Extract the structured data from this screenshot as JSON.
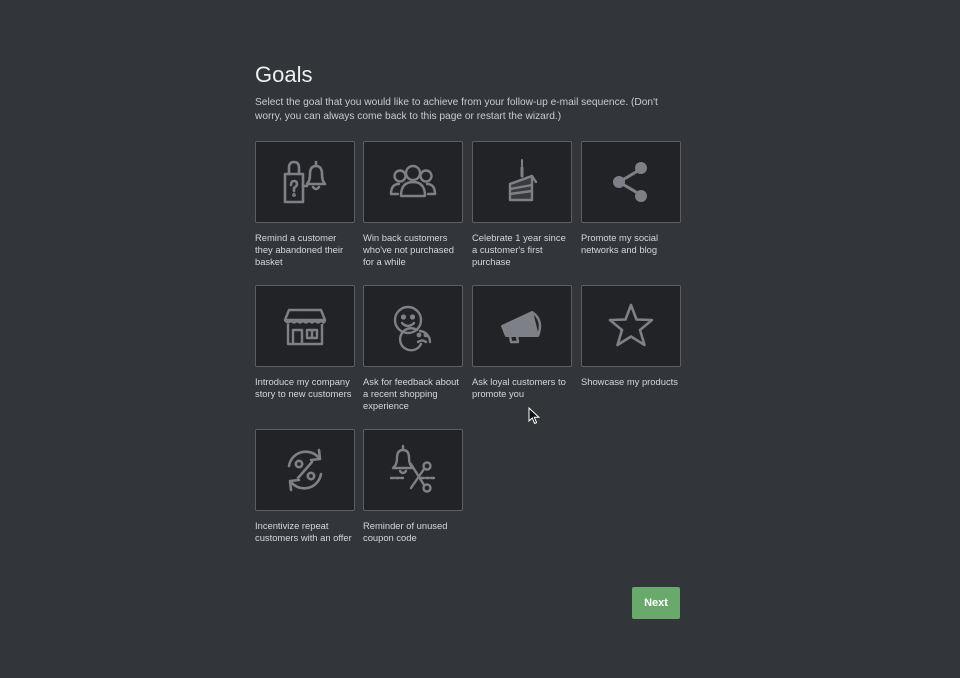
{
  "header": {
    "title": "Goals",
    "description": "Select the goal that you would like to achieve from your follow-up e-mail sequence. (Don't worry, you can always come back to this page or restart the wizard.)"
  },
  "goals": [
    {
      "label": "Remind a customer they abandoned their basket",
      "icon": "abandoned-basket-bell-icon"
    },
    {
      "label": "Win back customers who've not purchased for a while",
      "icon": "customers-group-icon"
    },
    {
      "label": "Celebrate 1 year since a customer's first purchase",
      "icon": "birthday-cake-icon"
    },
    {
      "label": "Promote my social networks and blog",
      "icon": "share-icon"
    },
    {
      "label": "Introduce my company story to new customers",
      "icon": "storefront-icon"
    },
    {
      "label": "Ask for feedback about a recent shopping experience",
      "icon": "feedback-faces-icon"
    },
    {
      "label": "Ask loyal customers to promote you",
      "icon": "megaphone-icon"
    },
    {
      "label": "Showcase my products",
      "icon": "star-icon"
    },
    {
      "label": "Incentivize repeat customers with an offer",
      "icon": "percent-refresh-icon"
    },
    {
      "label": "Reminder of unused coupon code",
      "icon": "bell-scissors-icon"
    }
  ],
  "footer": {
    "next_label": "Next"
  },
  "colors": {
    "background": "#32353a",
    "tile": "#222327",
    "tile_border": "#5b5f65",
    "icon": "#7d8187",
    "accent": "#6aa96c"
  }
}
